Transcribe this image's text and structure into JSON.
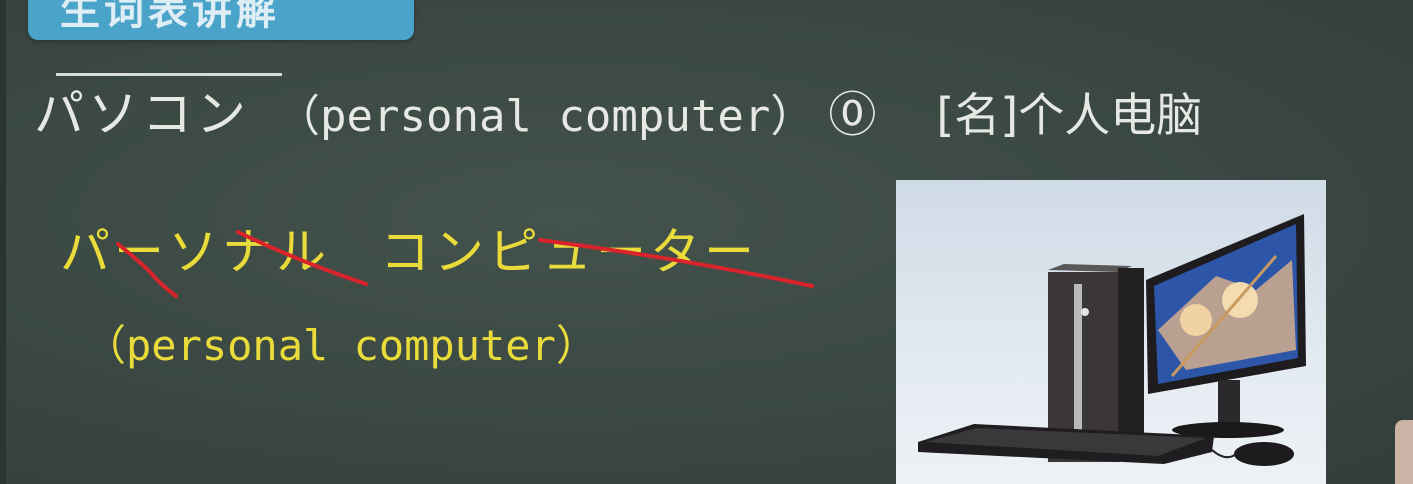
{
  "header": {
    "tab_title": "生词表讲解"
  },
  "vocab_entry": {
    "word": "パソコン",
    "origin": "（personal computer）",
    "accent": "⓪",
    "part_of_speech": "[名]",
    "meaning": "个人电脑"
  },
  "etymology": {
    "full_word_part1": "パーソナル",
    "full_word_part2": "コンピューター",
    "english": "（personal computer）"
  },
  "colors": {
    "board": "#3c4a44",
    "chalk_white": "#e6e8e4",
    "chalk_yellow": "#e9dc3a",
    "strike_red": "#d8242a",
    "tab_blue": "#4aa3c9"
  },
  "image": {
    "subject": "desktop-computer-icon"
  }
}
